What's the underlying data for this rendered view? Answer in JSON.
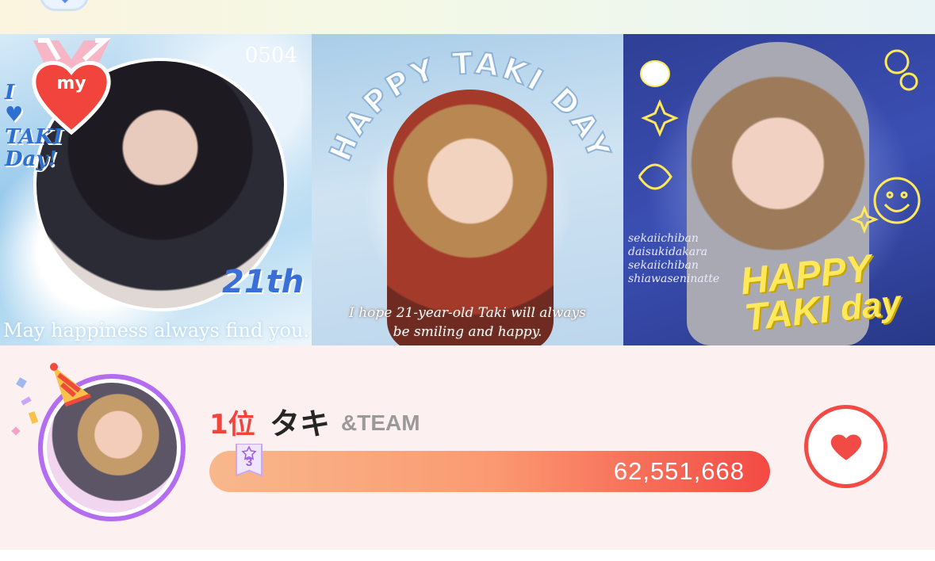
{
  "banner": {
    "tile1": {
      "badge_text": "my",
      "side_text": "I ♥ TAKI Day!",
      "date_text": "0504",
      "age_text": "21th",
      "caption": "May happiness always find you."
    },
    "tile2": {
      "arc_text": "HAPPY TAKI DAY",
      "caption_line1": "I hope 21-year-old Taki will always",
      "caption_line2": "be smiling and happy."
    },
    "tile3": {
      "side_lines": [
        "sekaiichiban",
        "daisukidakara",
        "sekaiichiban",
        "shiawaseninatte"
      ],
      "big_line1": "HAPPY",
      "big_line2": "TAKI",
      "big_line3": "day"
    }
  },
  "ranking": {
    "rank_label": "1位",
    "name": "タキ",
    "group": "&TEAM",
    "badge_number": "3",
    "vote_count": "62,551,668",
    "vote_fill": 1.0
  },
  "colors": {
    "accent_red": "#f24a45",
    "avatar_ring": "#b46cf0",
    "card_bg": "#fdf0f0"
  },
  "icons": {
    "heart_button": "heart-icon",
    "party": "party-hat-icon",
    "ribbon": "rank-ribbon-icon"
  }
}
